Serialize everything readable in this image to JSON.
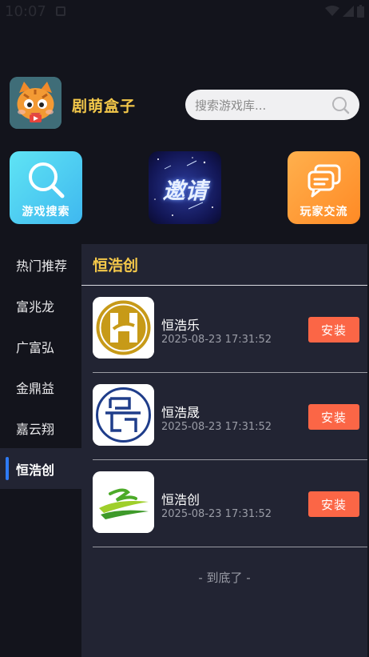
{
  "status_bar": {
    "time": "10:07"
  },
  "app": {
    "name": "剧萌盒子"
  },
  "search": {
    "placeholder": "搜索游戏库..."
  },
  "quick_actions": [
    {
      "label": "游戏搜索",
      "icon": "magnifier-icon"
    },
    {
      "label": "邀请",
      "icon": "starry-invite-banner"
    },
    {
      "label": "玩家交流",
      "icon": "chat-bubbles-icon"
    }
  ],
  "sidebar": {
    "items": [
      {
        "label": "热门推荐"
      },
      {
        "label": "富兆龙"
      },
      {
        "label": "广富弘"
      },
      {
        "label": "金鼎益"
      },
      {
        "label": "嘉云翔"
      },
      {
        "label": "恒浩创"
      }
    ],
    "active_index": 5
  },
  "panel": {
    "title": "恒浩创",
    "games": [
      {
        "name": "恒浩乐",
        "date": "2025-08-23 17:31:52",
        "button": "安装"
      },
      {
        "name": "恒浩晟",
        "date": "2025-08-23 17:31:52",
        "button": "安装"
      },
      {
        "name": "恒浩创",
        "date": "2025-08-23 17:31:52",
        "button": "安装"
      }
    ],
    "end_text": "- 到底了 -"
  },
  "colors": {
    "accent_yellow": "#f4c84a",
    "install_orange": "#fb6646",
    "active_indicator": "#2e7bf6",
    "panel_bg": "#222433",
    "page_bg": "#13141c"
  }
}
